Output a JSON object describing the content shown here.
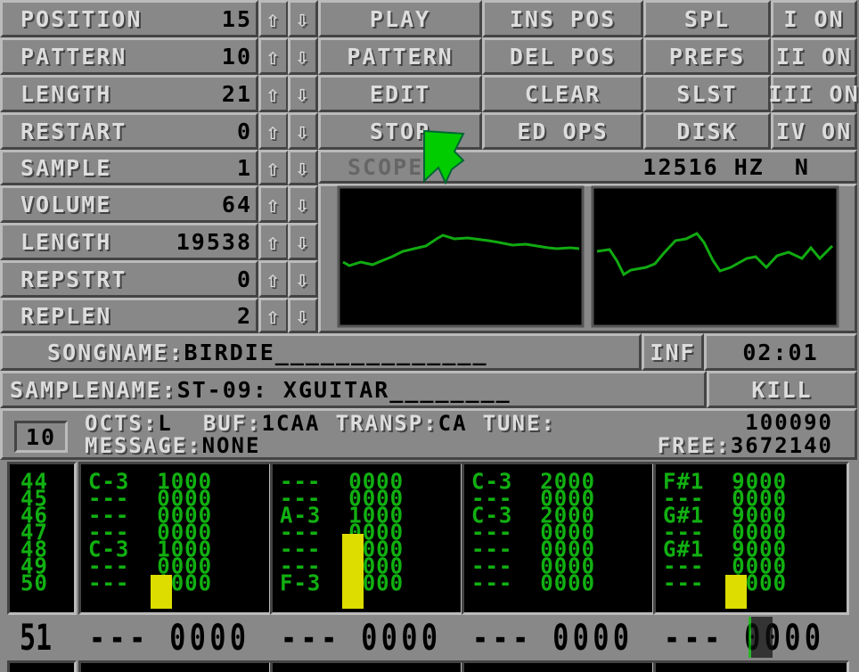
{
  "song": {
    "rows": [
      {
        "label": "POSITION",
        "value": "15"
      },
      {
        "label": "PATTERN",
        "value": "10"
      },
      {
        "label": "LENGTH",
        "value": "21"
      },
      {
        "label": "RESTART",
        "value": "0"
      }
    ]
  },
  "buttons": [
    [
      "PLAY",
      "INS POS",
      "SPL",
      "I ON"
    ],
    [
      "PATTERN",
      "DEL POS",
      "PREFS",
      "II ON"
    ],
    [
      "EDIT",
      "CLEAR",
      "SLST",
      "III ON"
    ],
    [
      "STOP",
      "ED OPS",
      "DISK",
      "IV ON"
    ]
  ],
  "sample": {
    "label": "SAMPLE",
    "value": "1"
  },
  "scope": {
    "label": "SCOPE",
    "rate": "12516 HZ  N"
  },
  "sample_params": [
    {
      "label": "VOLUME",
      "value": "64"
    },
    {
      "label": "LENGTH",
      "value": "19538"
    },
    {
      "label": "REPSTRT",
      "value": "0"
    },
    {
      "label": "REPLEN",
      "value": "2"
    }
  ],
  "songname": {
    "label": "SONGNAME:",
    "value": "BIRDIE______________"
  },
  "inf": "INF",
  "time": "02:01",
  "samplename": {
    "label": "SAMPLENAME:",
    "value": "ST-09: XGUITAR________"
  },
  "kill": "KILL",
  "info": {
    "octave_box": "10",
    "octs_label": "OCTS:",
    "octs": "L",
    "buf_label": "BUF:",
    "buf": "1CAA",
    "transp_label": "TRANSP:",
    "transp": "CA",
    "tune_label": "TUNE:",
    "tune": "100090",
    "message_label": "MESSAGE:",
    "message": "NONE",
    "free_label": "FREE:",
    "free": "3672140"
  },
  "pattern": {
    "row_numbers": [
      "44",
      "45",
      "46",
      "47",
      "48",
      "49",
      "50"
    ],
    "channels": [
      [
        "C-3  1000",
        "---  0000",
        "---  0000",
        "---  0000",
        "C-3  1000",
        "---  0000",
        "---  0000"
      ],
      [
        "---  0000",
        "---  0000",
        "A-3  1000",
        "---  0000",
        "---  0000",
        "---  0000",
        "F-3  1000"
      ],
      [
        "C-3  2000",
        "---  0000",
        "C-3  2000",
        "---  0000",
        "---  0000",
        "---  0000",
        "---  0000"
      ],
      [
        "F#1  9000",
        "---  0000",
        "G#1  9000",
        "---  0000",
        "G#1  9000",
        "---  0000",
        "---  0000"
      ]
    ],
    "current_row": {
      "number": "51",
      "cells": [
        "--- 0000",
        "--- 0000",
        "--- 0000",
        "--- 0000"
      ]
    },
    "volume_levels": [
      0.32,
      0.7,
      0,
      0.32
    ]
  },
  "colors": {
    "panel": "#888888",
    "pattern_text": "#11b011",
    "vu": "#dddd00",
    "cursor": "#00cc00"
  }
}
